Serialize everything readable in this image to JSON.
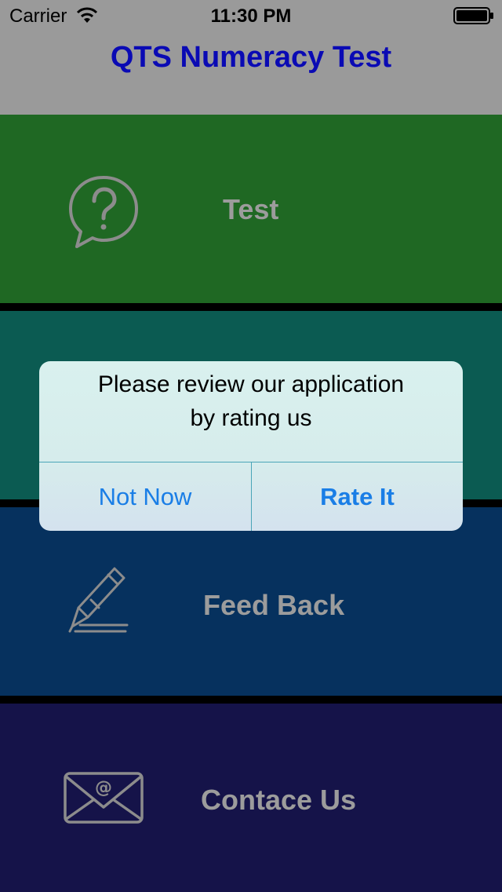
{
  "status_bar": {
    "carrier": "Carrier",
    "time": "11:30 PM"
  },
  "header": {
    "title": "QTS Numeracy Test",
    "title_color": "#0a0ab4"
  },
  "menu": {
    "items": [
      {
        "label": "Test",
        "icon": "question-bubble-icon",
        "color": "#1f6823"
      },
      {
        "label": "",
        "icon": "lightbulb-icon",
        "color": "#0b5b52"
      },
      {
        "label": "Feed Back",
        "icon": "pen-icon",
        "color": "#06315e"
      },
      {
        "label": "Contace Us",
        "icon": "mail-icon",
        "color": "#151349"
      }
    ]
  },
  "alert": {
    "message_line1": "Please review our application",
    "message_line2": "by rating us",
    "cancel_label": "Not Now",
    "confirm_label": "Rate It"
  }
}
